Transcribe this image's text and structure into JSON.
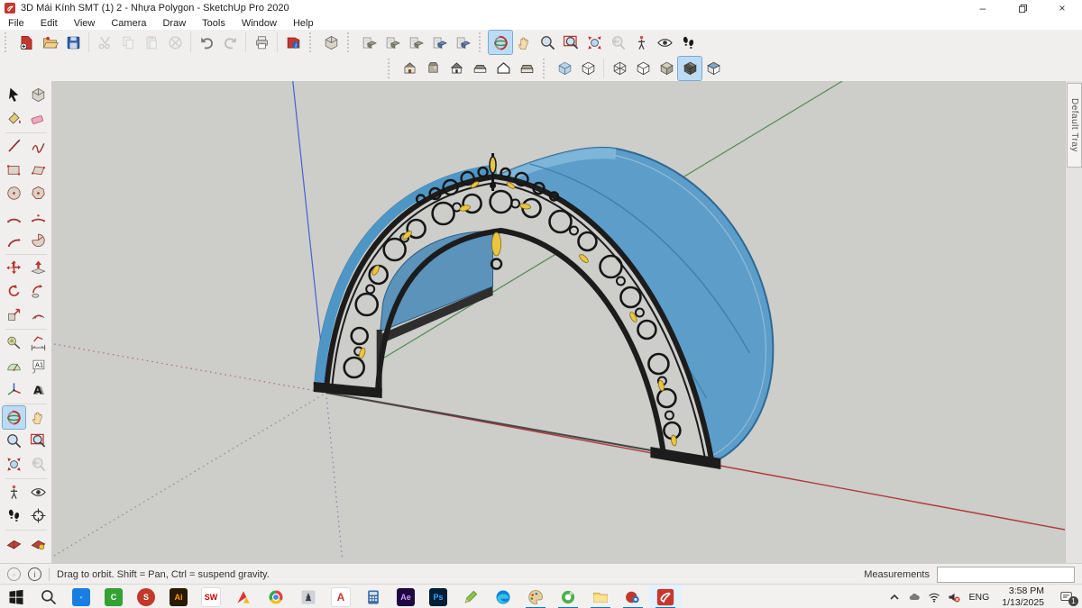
{
  "window": {
    "title": "3D Mái Kính SMT (1) 2 - Nhựa Polygon - SketchUp Pro 2020"
  },
  "menubar": {
    "items": [
      "File",
      "Edit",
      "View",
      "Camera",
      "Draw",
      "Tools",
      "Window",
      "Help"
    ]
  },
  "toolbars": {
    "standard_icons": [
      "new",
      "open",
      "save",
      "cut",
      "copy",
      "paste",
      "erase",
      "undo",
      "redo",
      "print",
      "model-info",
      "component",
      "clipboard-tool-1",
      "clipboard-tool-2",
      "clipboard-tool-3",
      "clipboard-tool-4",
      "clipboard-tool-5"
    ],
    "camera_icons": [
      "orbit",
      "pan",
      "zoom",
      "zoom-window",
      "zoom-extents",
      "zoom-previous",
      "position-camera",
      "look-around",
      "walk"
    ],
    "views_icons": [
      "iso",
      "top",
      "front",
      "right",
      "back",
      "left"
    ],
    "styles_icons": [
      "x-ray",
      "back-edges",
      "wireframe",
      "hidden-line",
      "shaded",
      "shaded-with-textures",
      "monochrome"
    ],
    "active_tool": "orbit",
    "active_style": "shaded-with-textures"
  },
  "palette_icons": [
    "select",
    "make-component",
    "paint-bucket",
    "eraser",
    "line",
    "freehand",
    "rectangle",
    "rotated-rectangle",
    "circle",
    "polygon",
    "arc",
    "2-point-arc",
    "3-point-arc",
    "pie",
    "move",
    "push-pull",
    "rotate",
    "follow-me",
    "scale",
    "offset",
    "tape-measure",
    "dimension",
    "protractor",
    "text",
    "axes",
    "3d-text",
    "orbit",
    "pan",
    "zoom",
    "zoom-window",
    "zoom-extents",
    "zoom-previous",
    "position-camera",
    "look-around",
    "walk",
    "section-plane",
    "section-display-1",
    "section-display-2"
  ],
  "viewport": {
    "tray_label": "Default Tray",
    "model_description": "Curved blue polycarbonate canopy with black wrought-iron ornamental front arch and gold leaf accents"
  },
  "statusbar": {
    "geo_icon": "geolocation",
    "info_icon": "credits",
    "hint": "Drag to orbit. Shift = Pan, Ctrl = suspend gravity.",
    "measurements_label": "Measurements",
    "measurements_value": ""
  },
  "taskbar": {
    "glyphs": {
      "camtasia": "C",
      "snagit": "S",
      "illustrator": "Ai",
      "solidworks": "SW",
      "autocad": "A",
      "aftereffects": "Ae",
      "photoshop": "Ps"
    },
    "language": "ENG",
    "time": "3:58 PM",
    "date": "1/13/2025",
    "notification_count": "1"
  },
  "colors": {
    "viewport_bg": "#cdcdca",
    "canopy_blue": "#5d9dc9",
    "canopy_rim_blue": "#4e96c6",
    "iron_black": "#1c1c1c",
    "gold": "#e9c63f",
    "active_tool_bg": "#bcdcf5",
    "taskbar_underline": "#0078d7",
    "axis_red": "#b03a3a",
    "axis_green": "#4e8f4e",
    "axis_blue": "#4a5fd0"
  }
}
